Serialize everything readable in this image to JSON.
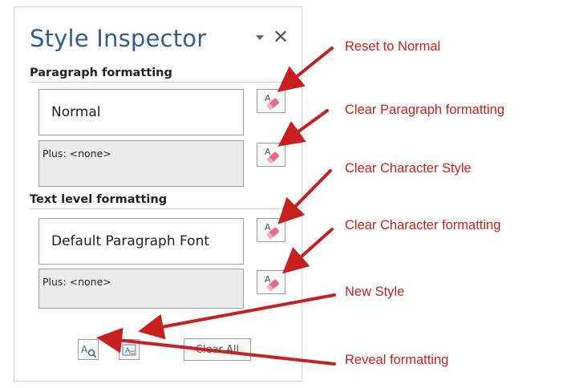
{
  "pane": {
    "title": "Style Inspector",
    "close_glyph": "✕",
    "paragraph_heading": "Paragraph formatting",
    "paragraph_style": "Normal",
    "paragraph_plus": "Plus: <none>",
    "text_heading": "Text level formatting",
    "text_style": "Default Paragraph Font",
    "text_plus": "Plus: <none>",
    "clear_all_label": "Clear All"
  },
  "annotations": {
    "reset_to_normal": "Reset to Normal",
    "clear_paragraph_formatting": "Clear Paragraph formatting",
    "clear_character_style": "Clear Character Style",
    "clear_character_formatting": "Clear Character formatting",
    "new_style": "New Style",
    "reveal_formatting": "Reveal formatting"
  },
  "icons": {
    "clear_buttons": "eraser-icon",
    "new_style": "new-style-icon",
    "reveal_formatting": "reveal-formatting-icon",
    "task_pane_options": "chevron-down-icon",
    "close": "close-icon"
  },
  "colors": {
    "title": "#2f5f8f",
    "annotation": "#c8201f",
    "eraser": "#e86a86"
  }
}
